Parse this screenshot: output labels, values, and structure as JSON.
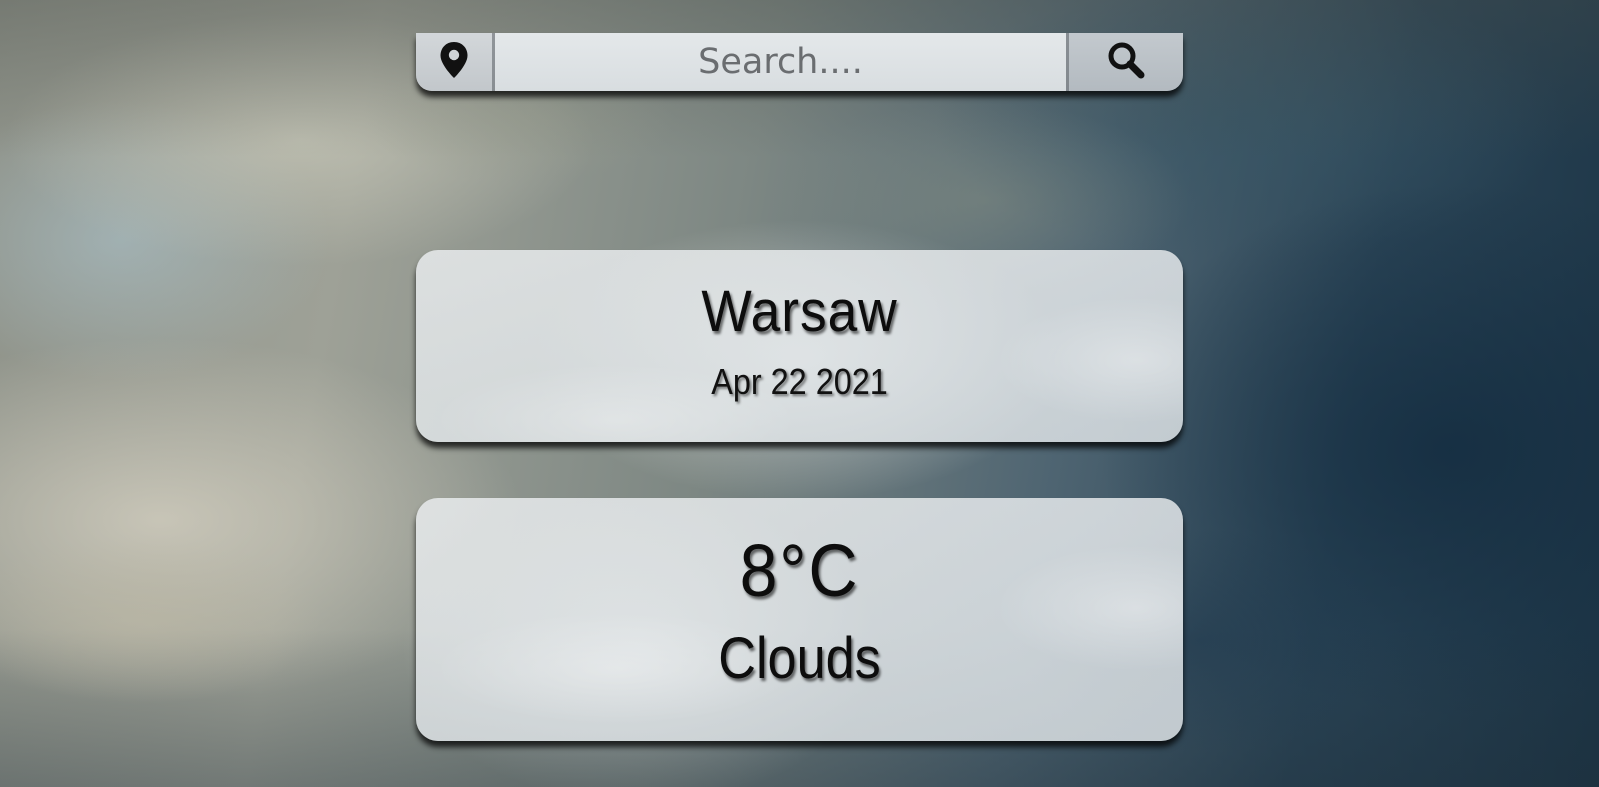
{
  "search": {
    "placeholder": "Search....",
    "value": "",
    "location_icon": "map-pin-icon",
    "search_icon": "magnifier-icon"
  },
  "location_card": {
    "city": "Warsaw",
    "date": "Apr 22 2021"
  },
  "weather_card": {
    "temperature": "8°C",
    "condition": "Clouds"
  },
  "colors": {
    "text": "#0d0d0d",
    "card_bg": "#e6eaec",
    "search_bg": "#dde1e4",
    "button_bg": "#c3c9ce"
  }
}
